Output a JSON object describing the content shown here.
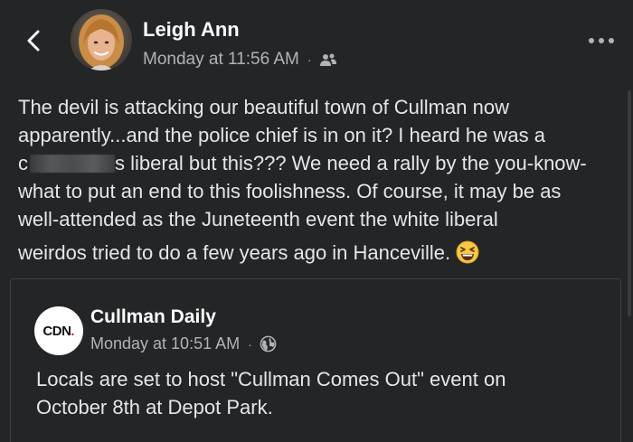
{
  "post": {
    "author_name": "Leigh Ann",
    "timestamp": "Monday at 11:56 AM",
    "separator": "·",
    "audience_icon": "friends-icon",
    "text_lines": [
      "The devil is attacking our beautiful town of Cullman now",
      "apparently...and the police chief is in on it? I heard he was a",
      "what to put an end to this foolishness. Of course, it may be as",
      "well-attended as the Juneteenth event the white liberal",
      "weirdos tried to do a few years ago in Hanceville."
    ],
    "redacted_line": {
      "prefix": "c",
      "suffix": "s liberal but this???  We need a rally by the you-know-"
    },
    "emoji": "grinning-squinting-face"
  },
  "shared_post": {
    "page_name": "Cullman Daily",
    "page_logo_text": "CDN",
    "page_logo_dot": ".",
    "timestamp": "Monday at 10:51 AM",
    "separator": "·",
    "audience_icon": "globe-icon",
    "text_lines": [
      "Locals are set to host \"Cullman Comes Out\" event on",
      "October 8th at Depot Park."
    ]
  },
  "colors": {
    "background": "#242526",
    "primary_text": "#e4e6eb",
    "secondary_text": "#b0b3b8",
    "card_border": "#3e4042"
  }
}
